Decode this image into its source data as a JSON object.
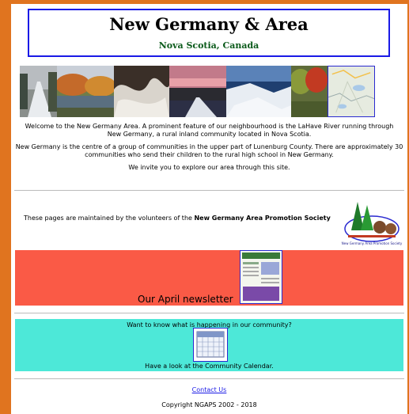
{
  "header": {
    "title": "New Germany & Area",
    "subtitle": "Nova Scotia, Canada"
  },
  "photos": [
    {
      "name": "snowy-road-photo"
    },
    {
      "name": "autumn-river-photo"
    },
    {
      "name": "waterfall-photo"
    },
    {
      "name": "sunset-road-photo"
    },
    {
      "name": "icy-river-photo"
    },
    {
      "name": "autumn-trees-photo"
    },
    {
      "name": "area-map-photo"
    }
  ],
  "intro": {
    "p1": "Welcome to the New Germany Area. A prominent feature of our neighbourhood is the LaHave River running through New Germany, a rural inland community located in Nova Scotia.",
    "p2": "New Germany is the centre of a group of communities in the upper part of Lunenburg County. There are approximately 30 communities who send their children to the rural high school in New Germany.",
    "p3": "We invite you to explore our area through this site."
  },
  "maintainers": {
    "text": "These pages are maintained by the volunteers of the ",
    "org": "New Germany Area Promotion Society",
    "logo_caption": "New Germany Area Promotion Society"
  },
  "newsletter": {
    "label": "Our April newsletter"
  },
  "calendar": {
    "top": "Want to know what is happening in our community?",
    "bottom": "Have a look at the Community Calendar."
  },
  "footer": {
    "contact": "Contact Us",
    "copyright": "Copyright NGAPS 2002 - 2018"
  },
  "colors": {
    "background": "#e0741f",
    "header_border": "#1a1ae6",
    "subtitle": "#0a5a1a",
    "newsletter_bg": "#fa5a46",
    "calendar_bg": "#4de8d8"
  }
}
